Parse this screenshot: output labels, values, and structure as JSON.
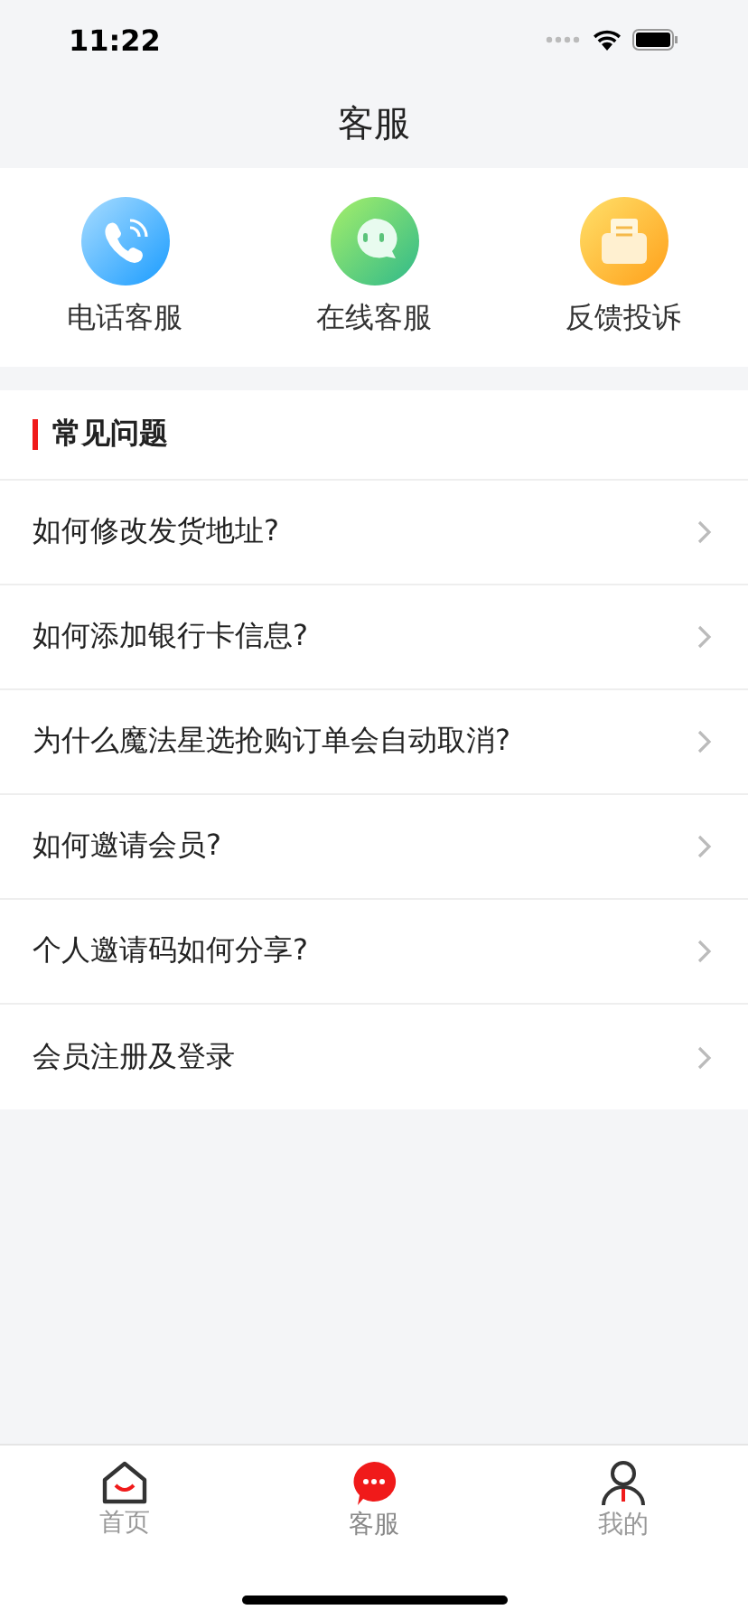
{
  "status_bar": {
    "time": "11:22"
  },
  "nav": {
    "title": "客服"
  },
  "services": [
    {
      "kind": "phone",
      "label": "电话客服"
    },
    {
      "kind": "chat",
      "label": "在线客服"
    },
    {
      "kind": "mail",
      "label": "反馈投诉"
    }
  ],
  "faq": {
    "title": "常见问题",
    "items": [
      "如何修改发货地址?",
      "如何添加银行卡信息?",
      "为什么魔法星选抢购订单会自动取消?",
      "如何邀请会员?",
      "个人邀请码如何分享?",
      "会员注册及登录"
    ]
  },
  "tabs": [
    {
      "kind": "home",
      "label": "首页",
      "selected": false
    },
    {
      "kind": "service",
      "label": "客服",
      "selected": true
    },
    {
      "kind": "profile",
      "label": "我的",
      "selected": false
    }
  ]
}
